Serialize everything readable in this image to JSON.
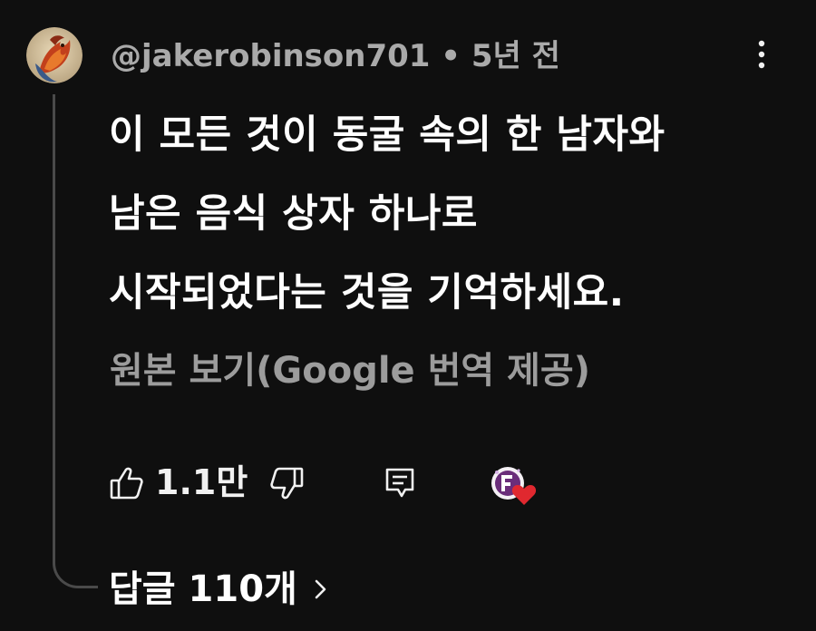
{
  "comment": {
    "username": "@jakerobinson701",
    "separator": " • ",
    "time_ago": "5년 전",
    "text_lines": [
      "이 모든 것이 동굴 속의 한 남자와",
      "남은 음식 상자 하나로",
      "시작되었다는 것을 기억하세요."
    ],
    "translation_link": "원본 보기(Google 번역 제공)",
    "like_count": "1.1만",
    "replies_label": "답글 110개"
  },
  "icons": {
    "menu": "vertical-dots-icon",
    "like": "thumbs-up-icon",
    "dislike": "thumbs-down-icon",
    "reply": "reply-comment-icon",
    "creator_heart": "creator-heart-icon",
    "chevron": "chevron-right-icon"
  },
  "colors": {
    "background": "#0f0f0f",
    "primary_text": "#ffffff",
    "secondary_text": "#aaaaaa",
    "heart": "#e0282f",
    "creator_badge": "#6a2d7a"
  }
}
